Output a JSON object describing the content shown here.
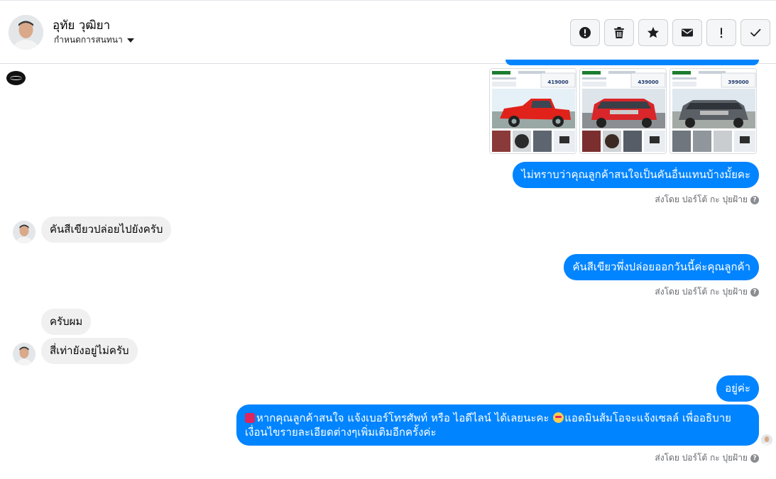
{
  "header": {
    "contact_name": "อุทัย วุฒิยา",
    "contact_subtitle": "กำหนดการสนทนา",
    "actions": [
      {
        "name": "report-button",
        "icon": "alert-circle-icon"
      },
      {
        "name": "delete-button",
        "icon": "trash-icon"
      },
      {
        "name": "star-button",
        "icon": "star-icon"
      },
      {
        "name": "mark-unread-button",
        "icon": "envelope-icon"
      },
      {
        "name": "spam-button",
        "icon": "exclamation-icon"
      },
      {
        "name": "mark-done-button",
        "icon": "checkmark-icon"
      }
    ]
  },
  "cars": [
    {
      "price": "419000",
      "color": "#e0221b"
    },
    {
      "price": "439000",
      "color": "#d8262a"
    },
    {
      "price": "399000",
      "color": "#5b6066"
    }
  ],
  "messages": {
    "out1": "ไม่ทราบว่าคุณลูกค้าสนใจเป็นคันอื่นแทนบ้างมั้ยคะ",
    "in1": "คันสีเขียวปล่อยไปยังครับ",
    "out2": "คันสีเขียวพึ่งปล่อยออกวันนี้ค่ะคุณลูกค้า",
    "in2": "ครับผม",
    "in3": "สี่เท่ายังอยู่ไม่ครับ",
    "out3": "อยู่ค่ะ",
    "out4_line1_a": "หากคุณลูกค้าสนใจ แจ้งเบอร์โทรศัพท์ หรือ ไอดีไลน์  ได้เลยนะคะ ",
    "out4_line1_b": "แอดมินส้มโอจะแจ้งเซลล์   เพื่ออธิบาย",
    "out4_line2": "เงื่อนไขรายละเอียดต่างๆเพิ่มเติมอีกครั้งค่ะ"
  },
  "sent_by": "ส่งโดย ปอร์โต้ กะ ปุยฝ้าย",
  "colors": {
    "outgoing": "#0084ff",
    "incoming": "#f0f0f0"
  }
}
